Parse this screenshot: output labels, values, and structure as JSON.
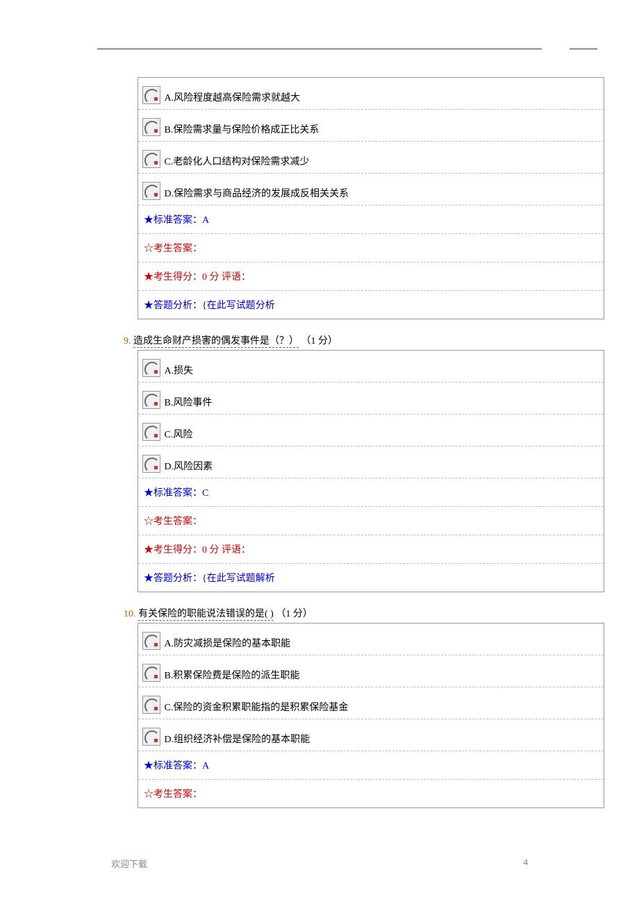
{
  "q8": {
    "options": {
      "a": "A.风险程度越高保险需求就越大",
      "b": "B.保险需求量与保险价格成正比关系",
      "c": "C.老龄化人口结构对保险需求减少",
      "d": "D.保险需求与商品经济的发展成反相关关系"
    },
    "answer_label": "★标准答案：A",
    "student_answer_label": "☆考生答案：",
    "score_label": "★考生得分：0 分   评语：",
    "analysis_label": "★答题分析：{在此写试题分析"
  },
  "q9": {
    "number": "9.",
    "title_part1": "造成生命财产损害的偶发事件是（？）",
    "title_part2": "（1 分）",
    "options": {
      "a": "A.损失",
      "b": "B.风险事件",
      "c": "C.风险",
      "d": "D.风险因素"
    },
    "answer_label": "★标准答案：C",
    "student_answer_label": "☆考生答案：",
    "score_label": "★考生得分：0 分   评语：",
    "analysis_label": "★答题分析：{在此写试题解析"
  },
  "q10": {
    "number": "10.",
    "title_part1": "有关保险的职能说法错误的是( )",
    "title_part2": "（1 分）",
    "options": {
      "a": "A.防灾减损是保险的基本职能",
      "b": "B.积累保险费是保险的派生职能",
      "c": "C.保险的资金积累职能指的是积累保险基金",
      "d": "D.组织经济补偿是保险的基本职能"
    },
    "answer_label": "★标准答案：A",
    "student_answer_label": "☆考生答案："
  },
  "footer": {
    "left": "欢迎下载",
    "right": "4"
  }
}
